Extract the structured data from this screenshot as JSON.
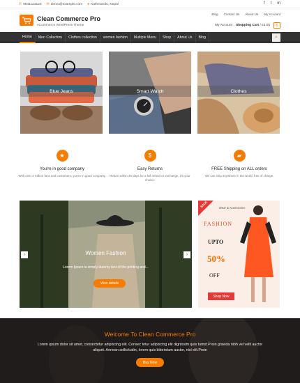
{
  "topbar": {
    "phone": "9841123123",
    "email": "demo@example.com",
    "location": "Kathmandu, Nepal",
    "social": [
      "f",
      "t",
      "in"
    ]
  },
  "header": {
    "site_title": "Clean Commerce Pro",
    "tagline": "eCommerce WordPress Theme",
    "links": [
      "Blog",
      "Contact Us",
      "About Us",
      "My Account"
    ],
    "my_account": "My Account",
    "cart_label": "Shopping Cart",
    "cart_total": "/ £0.00",
    "cart_count": "0"
  },
  "nav": {
    "items": [
      "Home",
      "Men Collection",
      "Clothes collection",
      "women fashion",
      "Multiple Menu",
      "Shop",
      "About Us",
      "Blog"
    ],
    "search_icon": "search-icon"
  },
  "categories": [
    {
      "label": "Blue Jeans"
    },
    {
      "label": "Smart Watch"
    },
    {
      "label": "Clothes"
    }
  ],
  "features": [
    {
      "icon": "star-icon",
      "title": "You're in good company",
      "desc": "With over 2 million fans and customers, you're in good company."
    },
    {
      "icon": "dollar-icon",
      "title": "Easy Returns",
      "desc": "Return within 30 days for a full refund or exchange, it's your choice."
    },
    {
      "icon": "truck-icon",
      "title": "FREE Shipping on ALL orders",
      "desc": "We can ship anywhere in the world, free of charge."
    }
  ],
  "slider": {
    "title": "Women Fashion",
    "subtitle": "Lorem Ipsum is simply dummy text of the printing and...",
    "button": "View details",
    "prev": "‹",
    "next": "›"
  },
  "ad": {
    "sale": "SALE",
    "tagline": "Wear & Accessories",
    "fashion": "FASHION",
    "upto": "UPTO",
    "percent": "50%",
    "off": "OFF",
    "shop": "Shop Now"
  },
  "welcome": {
    "title": "Welcome To Clean Commerce Pro",
    "text": "Lorem ipsum dolor sit amet, consectetur adipiscing elit. Consec tetur adipiscing elit dignissim quis tumst.Proin gravida nibh vel velit auctor aliquet. Aenean sollicitudin, lorem quis bibendum auctor, nisi elit.Proin",
    "button": "Buy Now"
  },
  "colors": {
    "accent": "#f57c00",
    "nav": "#333333",
    "dark": "#1f1c1b"
  }
}
